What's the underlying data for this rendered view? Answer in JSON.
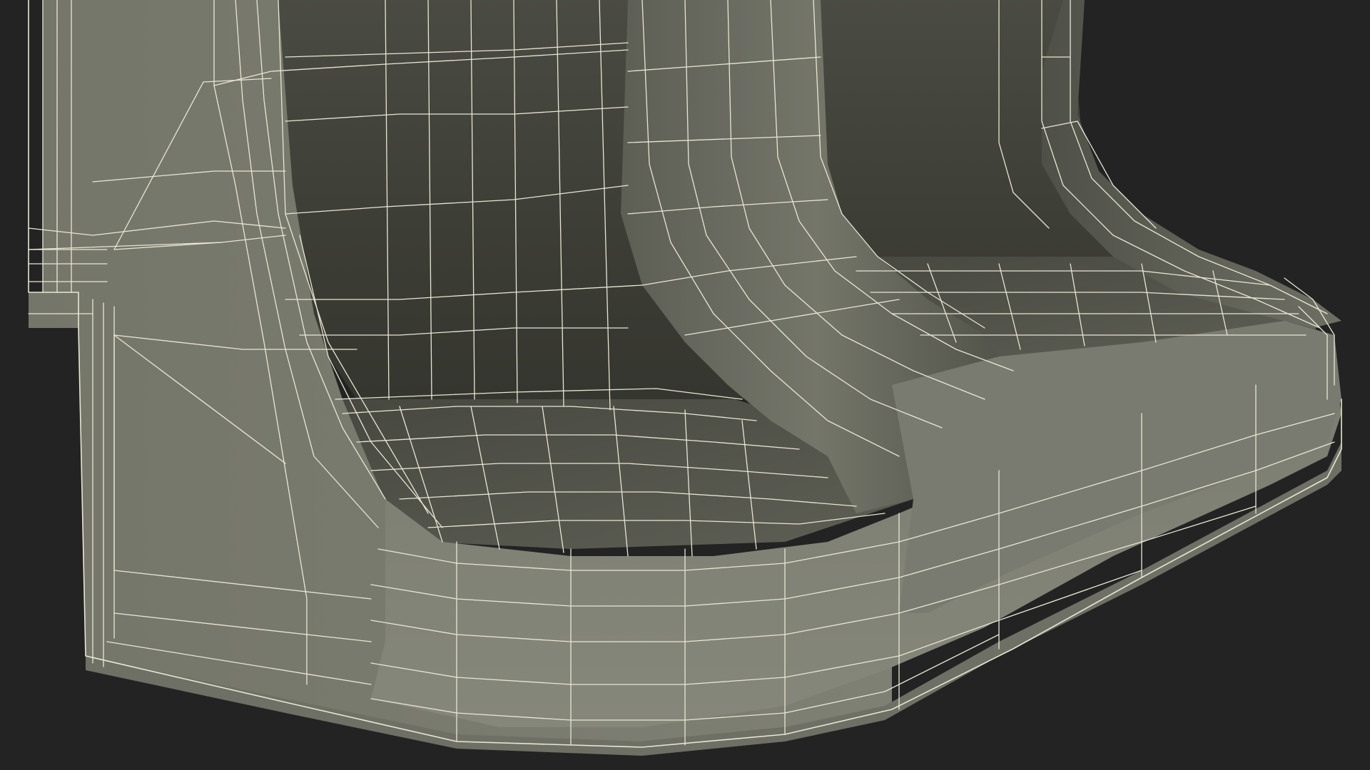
{
  "scene": {
    "background_color": "#232323",
    "surface_color_light": "#7e7f73",
    "surface_color_mid": "#6b6c61",
    "surface_color_dark": "#3a3b33",
    "wire_color": "#e8e6d4"
  }
}
